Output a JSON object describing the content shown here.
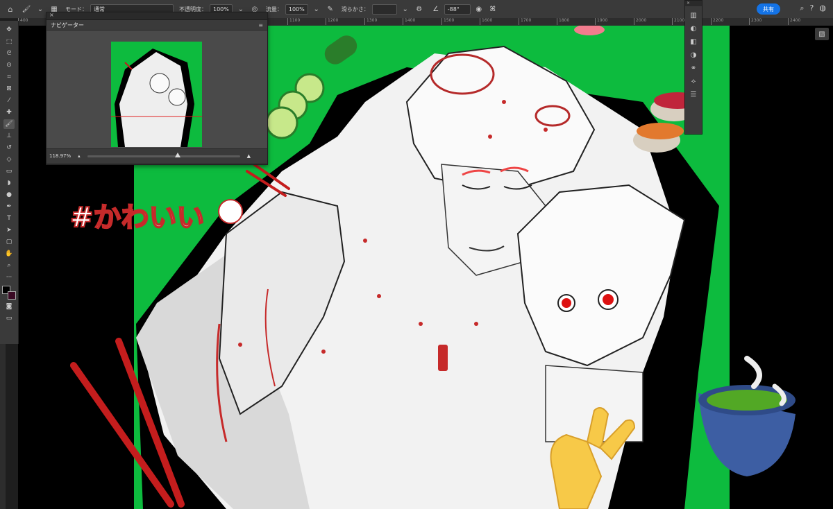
{
  "options_bar": {
    "mode_label": "モード：",
    "mode_value": "通常",
    "opacity_label": "不透明度：",
    "opacity_value": "100%",
    "flow_label": "流量：",
    "flow_value": "100%",
    "smoothing_label": "滑らかさ：",
    "smoothing_value": "",
    "angle_value": "-88°",
    "share_label": "共有"
  },
  "ruler": {
    "ticks": [
      "400",
      "500",
      "600",
      "700",
      "800",
      "900",
      "1000",
      "1100",
      "1200",
      "1300",
      "1400",
      "1500",
      "1600",
      "1700",
      "1800",
      "1900",
      "2000",
      "2100",
      "2200",
      "2300",
      "2400"
    ]
  },
  "navigator": {
    "title": "ナビゲーター",
    "zoom": "118.97%"
  },
  "artwork": {
    "hashtag_text": "#かわいい",
    "background_color": "#0dbb3e"
  },
  "colors": {
    "accent": "#1473e6",
    "artboard_green": "#0dbb3e",
    "panel_bg": "#3a3a3a"
  },
  "icons": {
    "home": "home-icon",
    "brush": "brush-icon",
    "airbrush": "airbrush-icon",
    "settings": "gear-icon",
    "pressure": "pressure-icon",
    "symmetry": "butterfly-icon",
    "search": "search-icon",
    "help": "help-icon",
    "account": "account-icon"
  }
}
